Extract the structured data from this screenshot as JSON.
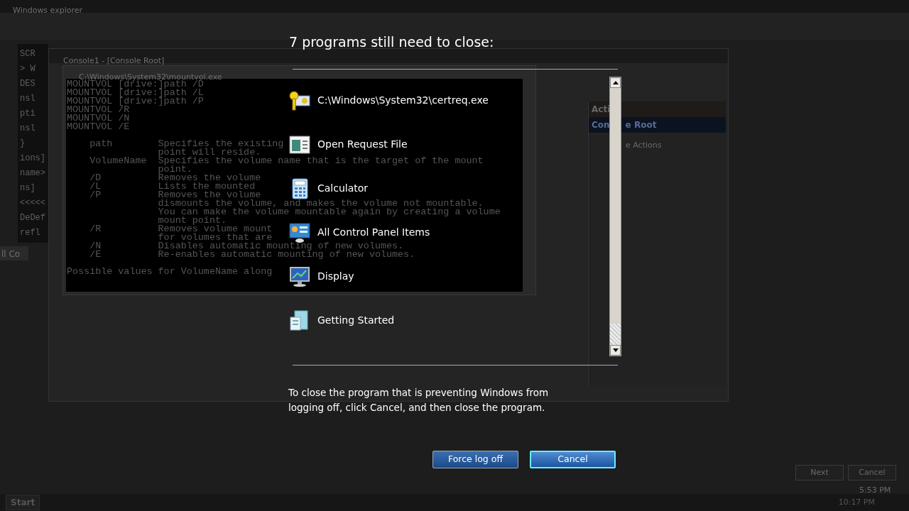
{
  "background": {
    "explorer_title": "Windows explorer",
    "left_code_lines": [
      "SCR",
      "> W",
      "DES",
      "nsl",
      "pti",
      "nsl",
      "}",
      "ions]",
      "name>",
      "ns]",
      "<<<<<",
      "DeDef",
      "refl"
    ],
    "mmc_title": "Console1 - [Console Root]",
    "console_title": "C:\\Windows\\System32\\mountvol.exe",
    "console_blocks": [
      [
        "MOUNTVOL [drive:]path /D",
        "MOUNTVOL [drive:]path /L",
        "MOUNTVOL [drive:]path /P",
        "MOUNTVOL /R",
        "MOUNTVOL /N",
        "MOUNTVOL /E"
      ],
      [
        "    path        Specifies the existing",
        "                point will reside.",
        "    VolumeName  Specifies the volume name that is the target of the mount",
        "                point.",
        "    /D          Removes the volume",
        "    /L          Lists the mounted",
        "    /P          Removes the volume",
        "                dismounts the volume, and makes the volume not mountable.",
        "                You can make the volume mountable again by creating a volume",
        "                mount point.",
        "    /R          Removes volume mount",
        "                for volumes that are",
        "    /N          Disables automatic mounting of new volumes.",
        "    /E          Re-enables automatic mounting of new volumes."
      ],
      [
        "Possible values for VolumeName along"
      ]
    ],
    "actions_header": "Acti",
    "actions_group": [
      "Con",
      "e Root"
    ],
    "actions_item": "e Actions",
    "side_tab": "ll Co",
    "wizard_buttons": [
      "Next",
      "Cancel"
    ],
    "wizard_time": "5:53 PM",
    "taskbar": {
      "start": "Start",
      "clock": "10:17 PM"
    }
  },
  "dialog": {
    "title": "7 programs still need to close:",
    "programs": [
      {
        "name": "C:\\Windows\\System32\\certreq.exe"
      },
      {
        "name": "Open Request File"
      },
      {
        "name": "Calculator"
      },
      {
        "name": "All Control Panel Items"
      },
      {
        "name": "Display"
      },
      {
        "name": "Getting Started"
      }
    ],
    "message": "To close the program that is preventing Windows from logging off, click Cancel, and then close the program.",
    "buttons": [
      {
        "label": "Force log off",
        "selected": false
      },
      {
        "label": "Cancel",
        "selected": true
      }
    ]
  }
}
